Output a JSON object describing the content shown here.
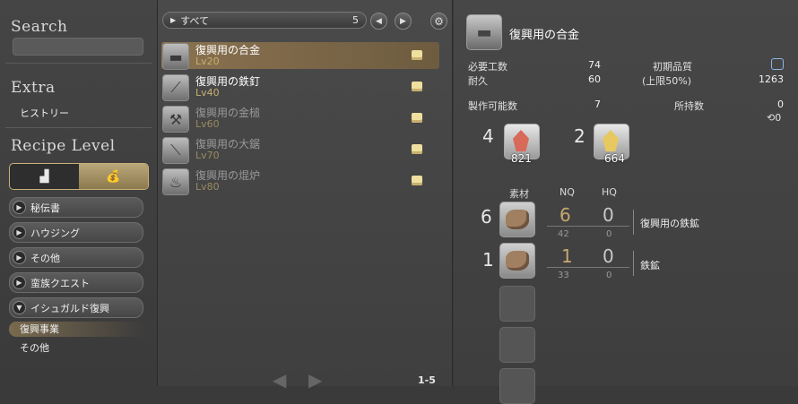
{
  "sidebar": {
    "search_title": "Search",
    "extra_title": "Extra",
    "history": "ヒストリー",
    "recipe_level_title": "Recipe Level",
    "categories": [
      "秘伝書",
      "ハウジング",
      "その他",
      "蛮族クエスト",
      "イシュガルド復興"
    ],
    "subitems": [
      "復興事業",
      "その他"
    ]
  },
  "list": {
    "filter_label": "すべて",
    "filter_count": "5",
    "pager": "1-5",
    "recipes": [
      {
        "name": "復興用の合金",
        "level": "Lv20",
        "icon": "metal-ingot-icon"
      },
      {
        "name": "復興用の鉄釘",
        "level": "Lv40",
        "icon": "iron-nails-icon"
      },
      {
        "name": "復興用の金槌",
        "level": "Lv60",
        "icon": "hammer-icon"
      },
      {
        "name": "復興用の大鋸",
        "level": "Lv70",
        "icon": "saw-icon"
      },
      {
        "name": "復興用の焜炉",
        "level": "Lv80",
        "icon": "stove-icon"
      }
    ]
  },
  "detail": {
    "name": "復興用の合金",
    "required_label": "必要工数",
    "required_value": "74",
    "durability_label": "耐久",
    "durability_value": "60",
    "initial_quality_label": "初期品質",
    "quality_cap": "(上限50%)",
    "quality_value": "1263",
    "craftable_label": "製作可能数",
    "craftable_value": "7",
    "owned_label": "所持数",
    "owned_value": "0",
    "owned_hq": "0",
    "crystals": [
      {
        "need": "4",
        "have": "821",
        "color": "#d86a5a",
        "icon": "fire-crystal-icon"
      },
      {
        "need": "2",
        "have": "664",
        "color": "#e8c860",
        "icon": "lightning-crystal-icon"
      }
    ],
    "col_material": "素材",
    "col_nq": "NQ",
    "col_hq": "HQ",
    "materials": [
      {
        "need": "6",
        "nq": "6",
        "hq": "0",
        "nq_owned": "42",
        "hq_owned": "0",
        "name": "復興用の鉄鉱",
        "icon": "ore-icon"
      },
      {
        "need": "1",
        "nq": "1",
        "hq": "0",
        "nq_owned": "33",
        "hq_owned": "0",
        "name": "鉄鉱",
        "icon": "ore-icon"
      }
    ]
  },
  "colors": {
    "accent": "#c8b070",
    "selected_row": "#8a7250"
  }
}
